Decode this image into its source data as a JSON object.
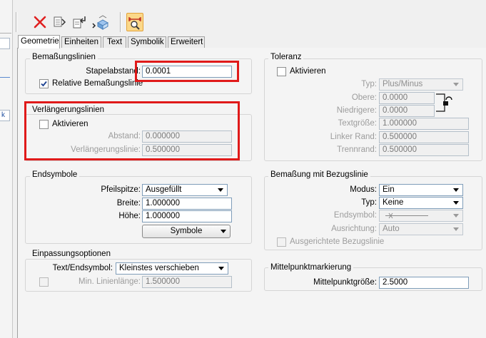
{
  "left_strip": {
    "item_label": "k"
  },
  "toolbar": {
    "icons": [
      "delete-icon",
      "copy-settings-icon",
      "paste-settings-icon",
      "stack-settings-icon",
      "dimension-measure-icon"
    ],
    "colors": {
      "delete": "#e02020",
      "active_bg": "#fbd889",
      "highlight_frame": "#e01a1a"
    }
  },
  "tabs": [
    {
      "label": "Geometrie",
      "active": true
    },
    {
      "label": "Einheiten",
      "active": false
    },
    {
      "label": "Text",
      "active": false
    },
    {
      "label": "Symbolik",
      "active": false
    },
    {
      "label": "Erweitert",
      "active": false
    }
  ],
  "bemassungslinien": {
    "title": "Bemaßungslinien",
    "stapelabstand_label": "Stapelabstand:",
    "stapelabstand_value": "0.0001",
    "relative_label": "Relative Bemaßungslinie",
    "relative_checked": true
  },
  "verlaengerungslinien": {
    "title": "Verlängerungslinien",
    "aktivieren_label": "Aktivieren",
    "abstand_label": "Abstand:",
    "abstand_value": "0.000000",
    "vlinie_label": "Verlängerungslinie:",
    "vlinie_value": "0.500000"
  },
  "toleranz": {
    "title": "Toleranz",
    "aktivieren_label": "Aktivieren",
    "typ_label": "Typ:",
    "typ_value": "Plus/Minus",
    "obere_label": "Obere:",
    "obere_value": "0.0000",
    "niedrigere_label": "Niedrigere:",
    "niedrigere_value": "0.0000",
    "textgroesse_label": "Textgröße:",
    "textgroesse_value": "1.000000",
    "linker_rand_label": "Linker Rand:",
    "linker_rand_value": "0.500000",
    "trennrand_label": "Trennrand:",
    "trennrand_value": "0.500000"
  },
  "endsymbole": {
    "title": "Endsymbole",
    "pfeilspitze_label": "Pfeilspitze:",
    "pfeilspitze_value": "Ausgefüllt",
    "breite_label": "Breite:",
    "breite_value": "1.000000",
    "hoehe_label": "Höhe:",
    "hoehe_value": "1.000000",
    "symbole_button": "Symbole"
  },
  "bezugslinie": {
    "title": "Bemaßung mit Bezugslinie",
    "modus_label": "Modus:",
    "modus_value": "Ein",
    "typ_label": "Typ:",
    "typ_value": "Keine",
    "endsymbol_label": "Endsymbol:",
    "ausrichtung_label": "Ausrichtung:",
    "ausrichtung_value": "Auto",
    "ausgerichtete_label": "Ausgerichtete Bezugslinie"
  },
  "einpassung": {
    "title": "Einpassungsoptionen",
    "text_label": "Text/Endsymbol:",
    "text_value": "Kleinstes verschieben",
    "min_label": "Min. Linienlänge:",
    "min_value": "1.500000"
  },
  "mittelpunkt": {
    "title": "Mittelpunktmarkierung",
    "groesse_label": "Mittelpunktgröße:",
    "groesse_value": "2.5000"
  }
}
